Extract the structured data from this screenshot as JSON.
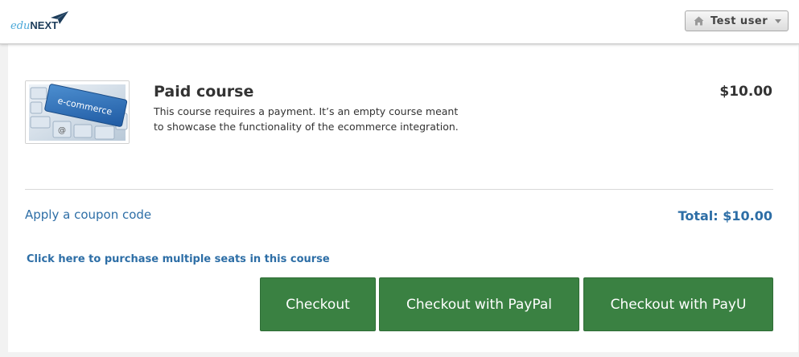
{
  "header": {
    "logo": {
      "part1": "edu",
      "part2": "NEXT"
    },
    "user_menu": {
      "label": "Test user",
      "icon": "home-icon"
    }
  },
  "course": {
    "image_text": "e-commerce",
    "title": "Paid course",
    "description": "This course requires a payment. It’s an empty course meant to showcase the functionality of the ecommerce integration.",
    "price": "$10.00"
  },
  "summary": {
    "coupon_link": "Apply a coupon code",
    "total": "Total: $10.00"
  },
  "multi_seat_link": "Click here to purchase multiple seats in this course",
  "buttons": {
    "checkout": "Checkout",
    "paypal": "Checkout with PayPal",
    "payu": "Checkout with PayU"
  },
  "colors": {
    "link": "#2d6ea6",
    "button": "#3a8142",
    "brand_light": "#4ba8d8",
    "brand_dark": "#1d3c5a"
  }
}
